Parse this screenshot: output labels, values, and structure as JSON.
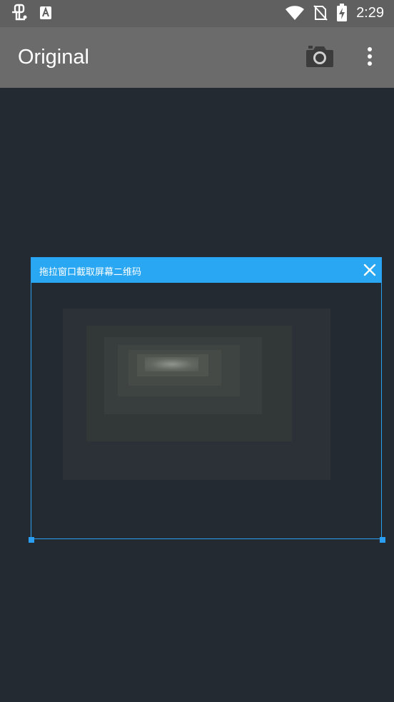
{
  "status_bar": {
    "time": "2:29",
    "left_icons": [
      "bug-icon",
      "text-a-icon"
    ],
    "right_icons": [
      "wifi-icon",
      "no-sim-icon",
      "battery-charging-icon"
    ]
  },
  "app_bar": {
    "title": "Original",
    "actions": [
      "camera-icon",
      "overflow-menu-icon"
    ],
    "background": "#6b6b6b"
  },
  "capture_window": {
    "title": "拖拉窗口截取屏幕二维码",
    "close_icon": "close-icon",
    "accent": "#2aa7f2"
  },
  "colors": {
    "status_bar": "#606060",
    "content_background": "#242a32"
  }
}
